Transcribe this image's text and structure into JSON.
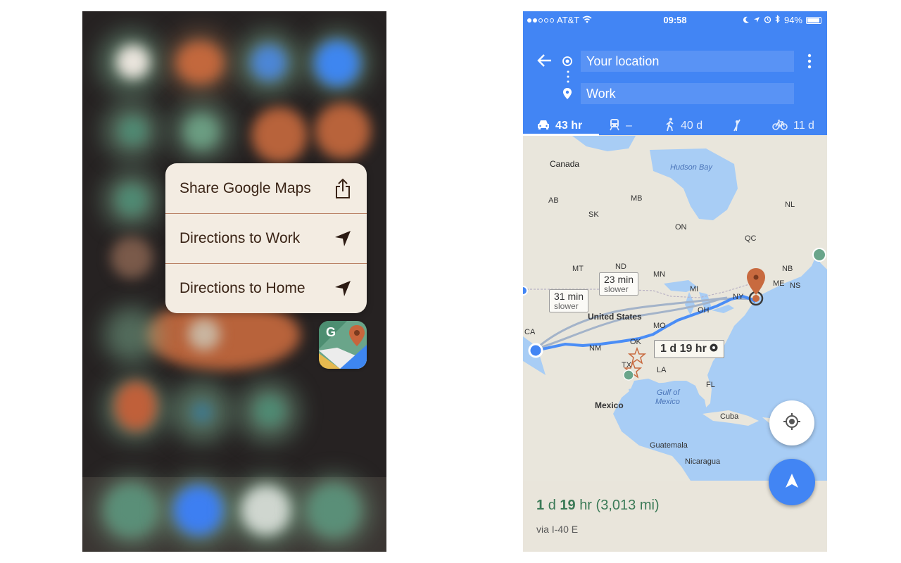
{
  "left_screen": {
    "quick_actions": [
      {
        "label": "Share Google Maps",
        "icon": "share-icon"
      },
      {
        "label": "Directions to Work",
        "icon": "navigation-arrow-icon"
      },
      {
        "label": "Directions to Home",
        "icon": "navigation-arrow-icon"
      }
    ],
    "app_icon": "google-maps-app-icon",
    "app_icon_letter": "G"
  },
  "right_screen": {
    "status_bar": {
      "carrier": "AT&T",
      "time": "09:58",
      "battery": "94%"
    },
    "directions": {
      "origin": "Your location",
      "destination": "Work"
    },
    "travel_modes": [
      {
        "mode": "drive",
        "icon": "car-icon",
        "value": "43 hr",
        "active": true
      },
      {
        "mode": "transit",
        "icon": "train-icon",
        "value": "–",
        "active": false
      },
      {
        "mode": "walk",
        "icon": "walk-icon",
        "value": "40 d",
        "active": false
      },
      {
        "mode": "ride",
        "icon": "hail-icon",
        "value": "",
        "active": false
      },
      {
        "mode": "bike",
        "icon": "bike-icon",
        "value": "11 d",
        "active": false
      }
    ],
    "map": {
      "labels": {
        "canada": "Canada",
        "hudson_bay": "Hudson Bay",
        "united_states": "United States",
        "mexico": "Mexico",
        "gulf": "Gulf of",
        "gulf2": "Mexico",
        "cuba": "Cuba",
        "guatemala": "Guatemala",
        "nicaragua": "Nicaragua",
        "sk": "SK",
        "mb": "MB",
        "on": "ON",
        "qc": "QC",
        "nl": "NL",
        "ab": "AB",
        "nb": "NB",
        "ns": "NS",
        "me": "ME",
        "mt": "MT",
        "nd": "ND",
        "mn": "MN",
        "mi": "MI",
        "ny": "NY",
        "oh": "OH",
        "ca": "CA",
        "nm": "NM",
        "ok": "OK",
        "mo": "MO",
        "tx": "TX",
        "la": "LA",
        "fl": "FL"
      },
      "alt_routes": [
        {
          "time": "31 min",
          "note": "slower"
        },
        {
          "time": "23 min",
          "note": "slower"
        }
      ],
      "primary_route": "1 d 19 hr"
    },
    "summary": {
      "duration_num1": "1",
      "duration_unit1": "d",
      "duration_num2": "19",
      "duration_unit2": "hr",
      "distance": "(3,013 mi)",
      "via": "via I-40 E"
    }
  },
  "colors": {
    "google_blue": "#4285f4",
    "menu_background": "#f3ece2",
    "route_blue": "#4a8df6",
    "pin_orange": "#c86a3f",
    "summary_green": "#3b7a57"
  }
}
